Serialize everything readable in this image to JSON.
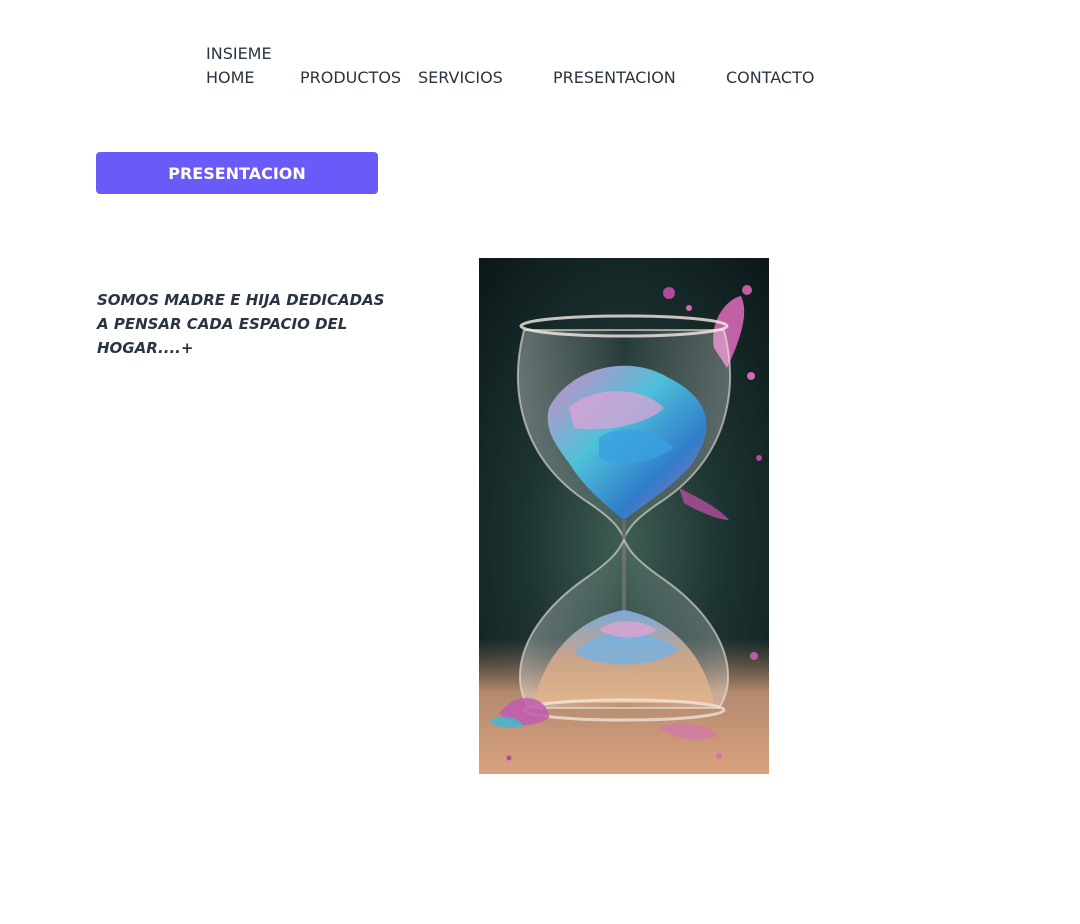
{
  "nav": {
    "home_label": "INSIEME HOME",
    "products_label": "PRODUCTOS",
    "services_label": "SERVICIOS",
    "presentation_label": "PRESENTACION",
    "contact_label": "CONTACTO"
  },
  "section": {
    "button_label": "PRESENTACION",
    "button_color": "#6a5af9",
    "tagline": "SOMOS MADRE E HIJA DEDICADAS A PENSAR CADA ESPACIO DEL HOGAR....+"
  },
  "image": {
    "subject": "hourglass-illustration-icon"
  }
}
